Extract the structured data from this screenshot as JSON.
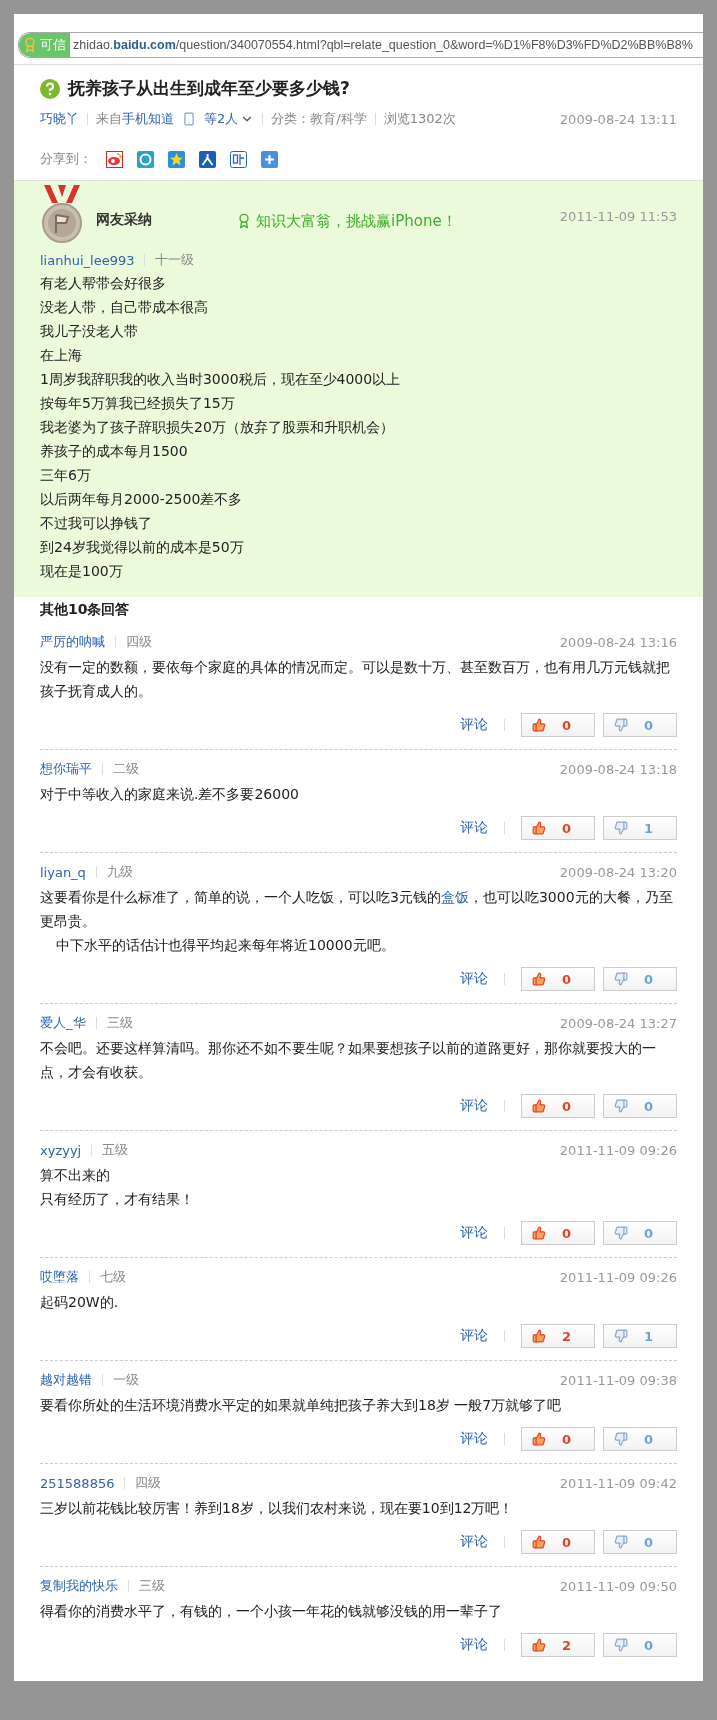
{
  "address_bar": {
    "badge": "可信",
    "url": "zhidao.**baidu.com**/question/340070554.html?qbl=relate_question_0&word=%D1%F8%D3%FD%D2%BB%B8%"
  },
  "question": {
    "title": "抚养孩子从出生到成年至少要多少钱?",
    "asker": "巧晓丫",
    "source_prefix": "来自",
    "source": "手机知道",
    "others": "等2人",
    "category": "分类：教育/科学",
    "views": "浏览1302次",
    "time": "2009-08-24 13:11"
  },
  "share": {
    "label": "分享到：",
    "buttons": [
      {
        "kind": "weibo"
      },
      {
        "kind": "p"
      },
      {
        "kind": "star"
      },
      {
        "kind": "person"
      },
      {
        "kind": "tie"
      },
      {
        "kind": "plus"
      }
    ]
  },
  "best_answer": {
    "badge": "网友采纳",
    "promo": "知识大富翁，挑战赢iPhone！",
    "time": "2011-11-09 11:53",
    "user": "lianhui_lee993",
    "level": "十一级",
    "lines": [
      "有老人帮带会好很多",
      "没老人带，自己带成本很高",
      "我儿子没老人带",
      "在上海",
      "1周岁我辞职我的收入当时3000税后，现在至少4000以上",
      "按每年5万算我已经损失了15万",
      "我老婆为了孩子辞职损失20万（放弃了股票和升职机会）",
      "养孩子的成本每月1500",
      "三年6万",
      "以后两年每月2000-2500差不多",
      "不过我可以挣钱了",
      "到24岁我觉得以前的成本是50万",
      "现在是100万"
    ]
  },
  "other_answers": {
    "heading": "其他10条回答",
    "items": [
      {
        "user": "严厉的呐喊",
        "level": "四级",
        "time": "2009-08-24 13:16",
        "paragraphs": [
          {
            "segments": [
              {
                "text": "没有一定的数额，要依每个家庭的具体的情况而定。可以是数十万、甚至数百万，也有用几万元钱就把孩子抚育成人的。",
                "kind": "plain"
              }
            ]
          }
        ],
        "comment": "评论",
        "likes": "0",
        "dislikes": "0"
      },
      {
        "user": "想你瑞平",
        "level": "二级",
        "time": "2009-08-24 13:18",
        "paragraphs": [
          {
            "segments": [
              {
                "text": "对于中等收入的家庭来说.差不多要26000",
                "kind": "plain"
              }
            ]
          }
        ],
        "comment": "评论",
        "likes": "0",
        "dislikes": "1"
      },
      {
        "user": "liyan_q",
        "level": "九级",
        "time": "2009-08-24 13:20",
        "paragraphs": [
          {
            "segments": [
              {
                "text": "这要看你是什么标准了，简单的说，一个人吃饭，可以吃3元钱的",
                "kind": "plain"
              },
              {
                "text": "盒饭",
                "kind": "link"
              },
              {
                "text": "，也可以吃3000元的大餐，乃至更昂贵。",
                "kind": "plain"
              }
            ]
          },
          {
            "indented": true,
            "segments": [
              {
                "text": "中下水平的话估计也得平均起来每年将近10000元吧。",
                "kind": "plain"
              }
            ]
          }
        ],
        "comment": "评论",
        "likes": "0",
        "dislikes": "0"
      },
      {
        "user": "爱人_华",
        "level": "三级",
        "time": "2009-08-24 13:27",
        "paragraphs": [
          {
            "segments": [
              {
                "text": "不会吧。还要这样算清吗。那你还不如不要生呢？如果要想孩子以前的道路更好，那你就要投大的一点，才会有收获。",
                "kind": "plain"
              }
            ]
          }
        ],
        "comment": "评论",
        "likes": "0",
        "dislikes": "0"
      },
      {
        "user": "xyzyyj",
        "level": "五级",
        "time": "2011-11-09 09:26",
        "paragraphs": [
          {
            "segments": [
              {
                "text": "算不出来的",
                "kind": "plain"
              }
            ]
          },
          {
            "segments": [
              {
                "text": "只有经历了，才有结果！",
                "kind": "plain"
              }
            ]
          }
        ],
        "comment": "评论",
        "likes": "0",
        "dislikes": "0"
      },
      {
        "user": "哎堕落",
        "level": "七级",
        "time": "2011-11-09 09:26",
        "paragraphs": [
          {
            "segments": [
              {
                "text": "起码20W的.",
                "kind": "plain"
              }
            ]
          }
        ],
        "comment": "评论",
        "likes": "2",
        "dislikes": "1"
      },
      {
        "user": "越对越错",
        "level": "一级",
        "time": "2011-11-09 09:38",
        "paragraphs": [
          {
            "segments": [
              {
                "text": "要看你所处的生活环境消费水平定的如果就单纯把孩子养大到18岁 一般7万就够了吧",
                "kind": "plain"
              }
            ]
          }
        ],
        "comment": "评论",
        "likes": "0",
        "dislikes": "0"
      },
      {
        "user": "251588856",
        "level": "四级",
        "time": "2011-11-09 09:42",
        "paragraphs": [
          {
            "segments": [
              {
                "text": "三岁以前花钱比较厉害！养到18岁，以我们农村来说，现在要10到12万吧！",
                "kind": "plain"
              }
            ]
          }
        ],
        "comment": "评论",
        "likes": "0",
        "dislikes": "0"
      },
      {
        "user": "复制我的快乐",
        "level": "三级",
        "time": "2011-11-09 09:50",
        "paragraphs": [
          {
            "segments": [
              {
                "text": "得看你的消费水平了，有钱的，一个小孩一年花的钱就够没钱的用一辈子了",
                "kind": "plain"
              }
            ]
          }
        ],
        "comment": "评论",
        "likes": "2",
        "dislikes": "0"
      }
    ]
  }
}
